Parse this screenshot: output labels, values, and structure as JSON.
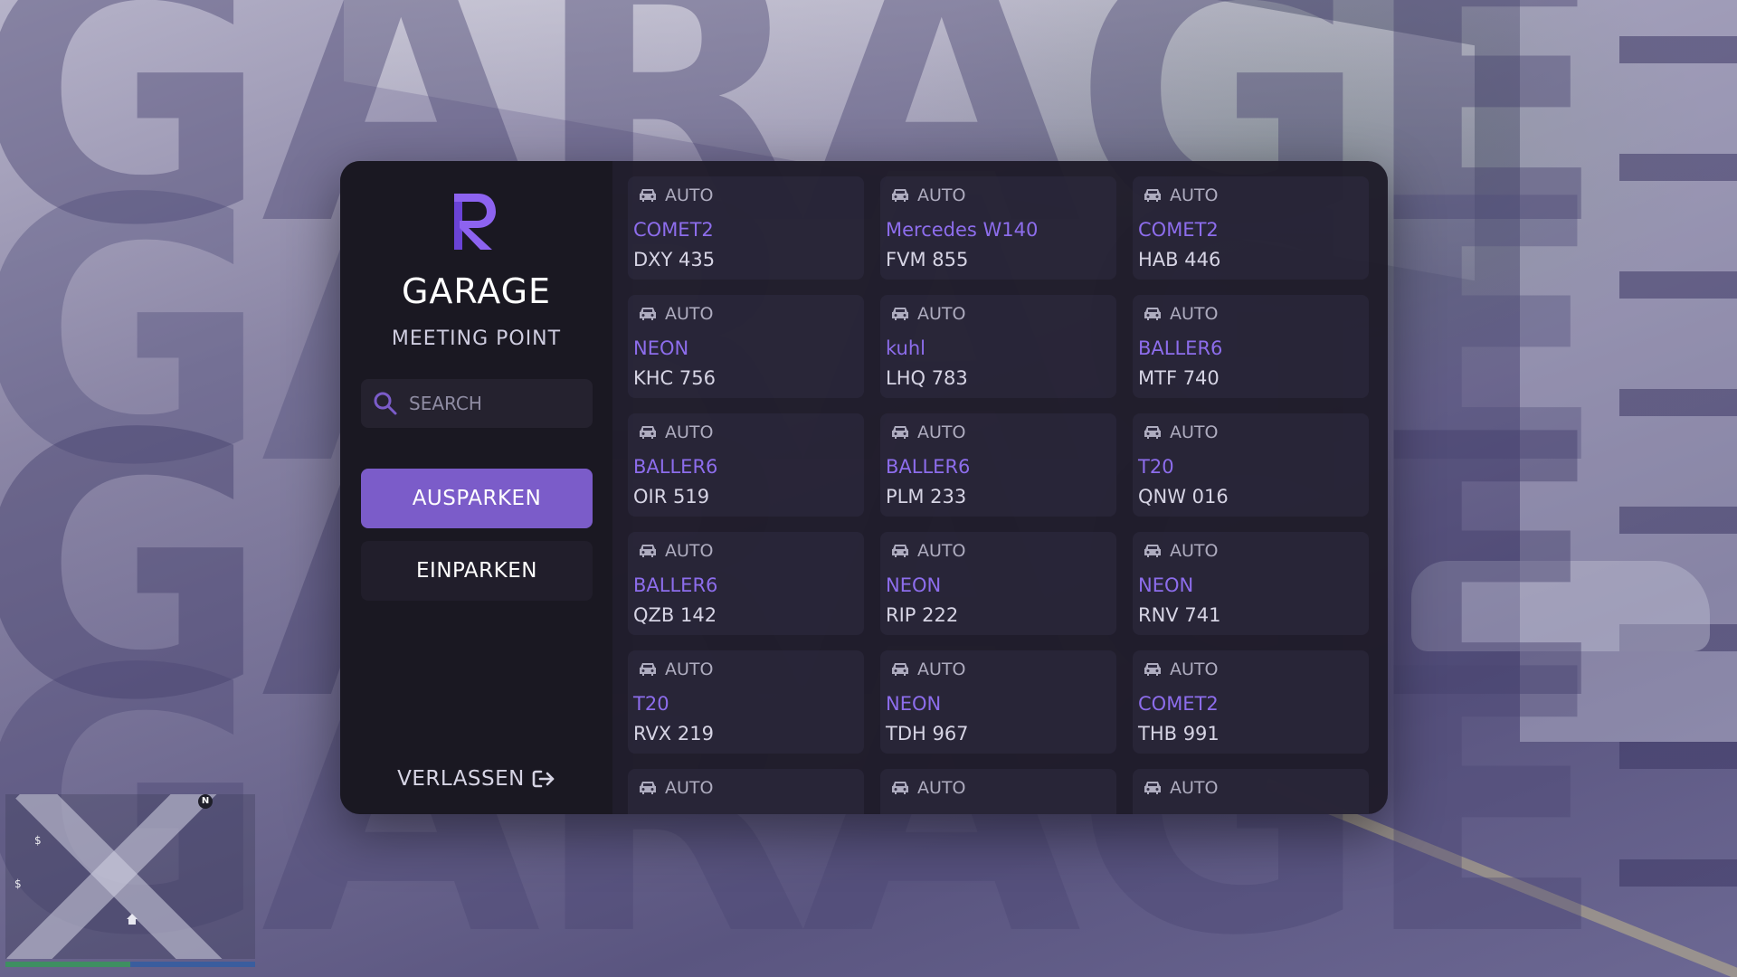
{
  "background": {
    "watermark_word": "GARAGE"
  },
  "minimap": {
    "north_label": "N",
    "blip_a": "$",
    "blip_b": "$",
    "player_icon": "house-blip-icon",
    "health_color": "#3e8f61",
    "armor_color": "#3a5d9e"
  },
  "colors": {
    "accent": "#7b5cc9",
    "model_text": "#8d6dec",
    "panel_bg": "#1e1b29"
  },
  "sidebar": {
    "logo_icon": "r-logo-icon",
    "title": "GARAGE",
    "subtitle": "MEETING POINT",
    "search": {
      "icon": "search-icon",
      "placeholder": "SEARCH",
      "value": ""
    },
    "primary_button": "AUSPARKEN",
    "secondary_button": "EINPARKEN",
    "leave": {
      "label": "VERLASSEN",
      "icon": "exit-icon"
    }
  },
  "vehicles": [
    {
      "type": "AUTO",
      "model": "COMET2",
      "plate": "DXY 435"
    },
    {
      "type": "AUTO",
      "model": "Mercedes W140",
      "plate": "FVM 855"
    },
    {
      "type": "AUTO",
      "model": "COMET2",
      "plate": "HAB 446"
    },
    {
      "type": "AUTO",
      "model": "NEON",
      "plate": "KHC 756"
    },
    {
      "type": "AUTO",
      "model": "kuhl",
      "plate": "LHQ 783"
    },
    {
      "type": "AUTO",
      "model": "BALLER6",
      "plate": "MTF 740"
    },
    {
      "type": "AUTO",
      "model": "BALLER6",
      "plate": "OIR 519"
    },
    {
      "type": "AUTO",
      "model": "BALLER6",
      "plate": "PLM 233"
    },
    {
      "type": "AUTO",
      "model": "T20",
      "plate": "QNW 016"
    },
    {
      "type": "AUTO",
      "model": "BALLER6",
      "plate": "QZB 142"
    },
    {
      "type": "AUTO",
      "model": "NEON",
      "plate": "RIP 222"
    },
    {
      "type": "AUTO",
      "model": "NEON",
      "plate": "RNV 741"
    },
    {
      "type": "AUTO",
      "model": "T20",
      "plate": "RVX 219"
    },
    {
      "type": "AUTO",
      "model": "NEON",
      "plate": "TDH 967"
    },
    {
      "type": "AUTO",
      "model": "COMET2",
      "plate": "THB 991"
    },
    {
      "type": "AUTO",
      "model": "",
      "plate": ""
    },
    {
      "type": "AUTO",
      "model": "",
      "plate": ""
    },
    {
      "type": "AUTO",
      "model": "",
      "plate": ""
    }
  ]
}
